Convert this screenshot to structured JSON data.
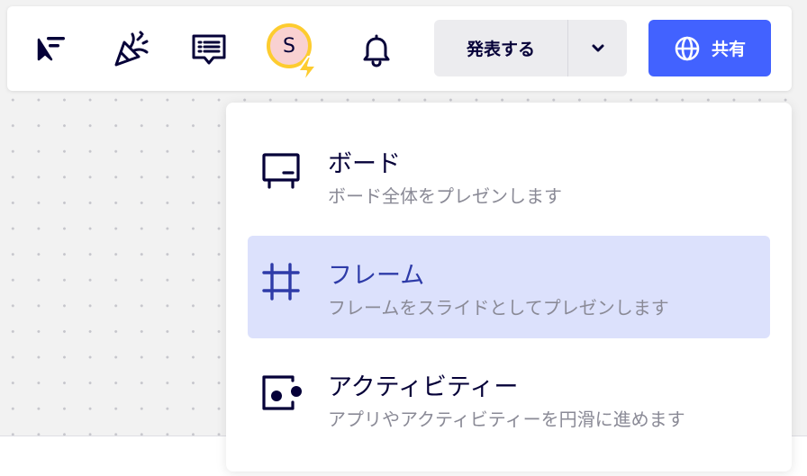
{
  "toolbar": {
    "icons": [
      "cursor-collab-icon",
      "celebrate-icon",
      "comments-icon",
      "bell-icon"
    ],
    "avatar": {
      "initial": "S",
      "ring_color": "#fdcc2f",
      "fill_color": "#f9d1d1",
      "badge": "bolt-icon"
    },
    "present_label": "発表する",
    "present_dropdown_icon": "chevron-down-icon",
    "share": {
      "label": "共有",
      "icon": "globe-icon",
      "color": "#4262ff"
    }
  },
  "present_menu": {
    "items": [
      {
        "title": "ボード",
        "description": "ボード全体をプレゼンします",
        "icon": "board-icon",
        "selected": false
      },
      {
        "title": "フレーム",
        "description": "フレームをスライドとしてプレゼンします",
        "icon": "frame-icon",
        "selected": true
      },
      {
        "title": "アクティビティー",
        "description": "アプリやアクティビティーを円滑に進めます",
        "icon": "activity-icon",
        "selected": false
      }
    ],
    "selected_color": "#dce1fc"
  }
}
